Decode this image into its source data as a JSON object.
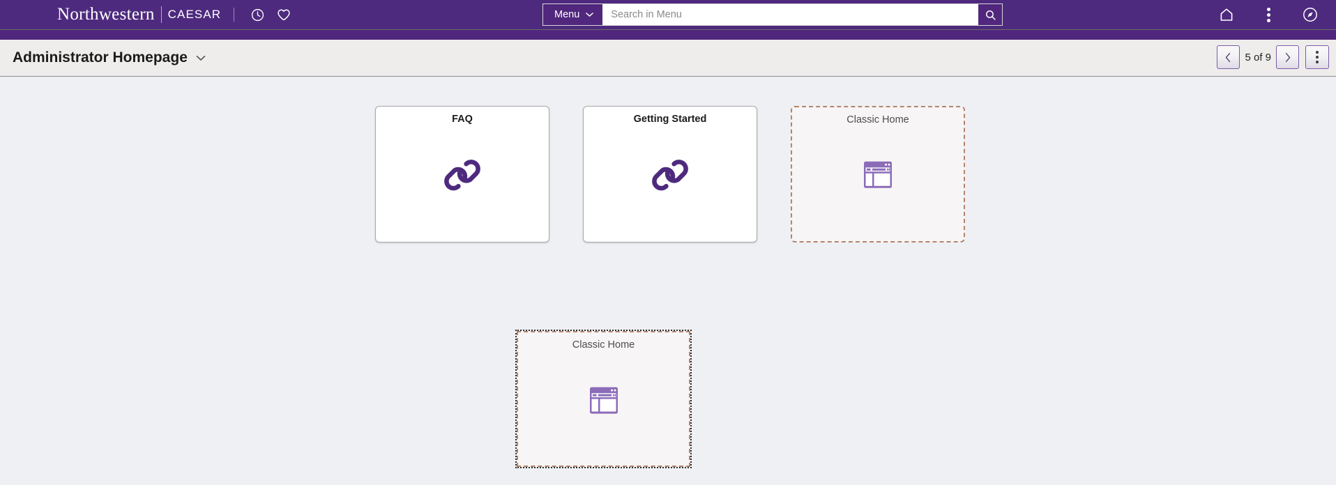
{
  "header": {
    "brand_name": "Northwestern",
    "brand_sub": "CAESAR",
    "brand_color": "#4e2a7e",
    "icons": [
      {
        "name": "recent-history-icon",
        "label": "Recently Visited"
      },
      {
        "name": "favorites-heart-icon",
        "label": "Favorites"
      }
    ],
    "search": {
      "menu_label": "Menu",
      "placeholder": "Search in Menu",
      "value": "",
      "submit_name": "search-icon"
    },
    "right_icons": [
      {
        "name": "home-icon",
        "label": "Home"
      },
      {
        "name": "actions-list-icon",
        "label": "Actions List"
      },
      {
        "name": "navbar-compass-icon",
        "label": "NavBar"
      }
    ]
  },
  "titlebar": {
    "title": "Administrator Homepage",
    "caret_name": "chevron-down-icon",
    "pager": {
      "prev_label": "‹",
      "next_label": "›",
      "count": "5 of 9",
      "actions_name": "more-actions-icon"
    }
  },
  "tiles": [
    {
      "title": "FAQ",
      "icon": "link-chain-icon",
      "state": "normal"
    },
    {
      "title": "Getting Started",
      "icon": "link-chain-icon",
      "state": "normal"
    },
    {
      "title": "Classic Home",
      "icon": "classic-home-window-icon",
      "state": "drop-placeholder"
    }
  ],
  "drag_tile": {
    "title": "Classic Home",
    "icon": "classic-home-window-icon",
    "state": "dragging"
  },
  "colors": {
    "page_background": "#eef0f4",
    "header_purple": "#4e2a7e",
    "stripe_purple": "#51277d",
    "titlebar_background": "#eeedec",
    "accent_purple": "#51277d",
    "placeholder_border": "#b5846b",
    "placeholder_fill": "#f7f5f6"
  }
}
